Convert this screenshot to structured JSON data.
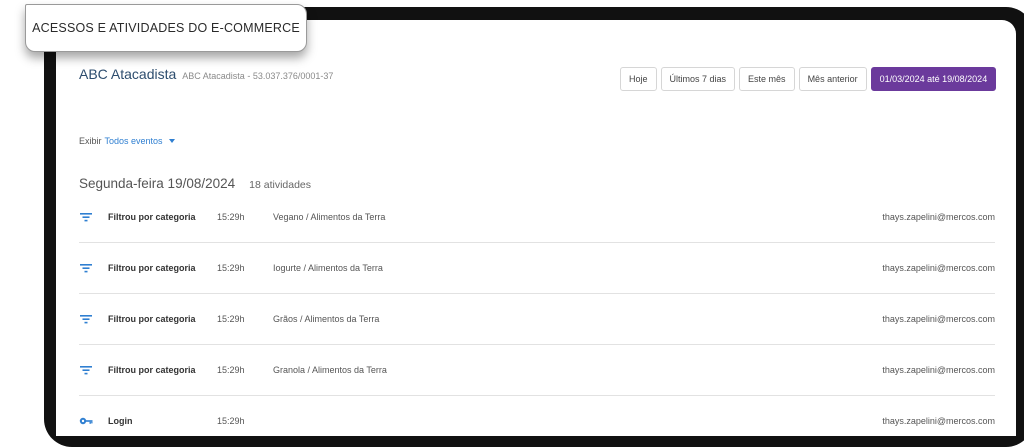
{
  "caption": "ACESSOS E ATIVIDADES DO E-COMMERCE",
  "company": {
    "name": "ABC Atacadista",
    "subtitle": "ABC Atacadista - 53.037.376/0001-37"
  },
  "period_filters": [
    {
      "label": "Hoje",
      "active": false
    },
    {
      "label": "Últimos 7 dias",
      "active": false
    },
    {
      "label": "Este mês",
      "active": false
    },
    {
      "label": "Mês anterior",
      "active": false
    },
    {
      "label": "01/03/2024 até 19/08/2024",
      "active": true
    }
  ],
  "event_filter": {
    "label": "Exibir",
    "value": "Todos eventos"
  },
  "day": {
    "date": "Segunda-feira 19/08/2024",
    "count": "18 atividades"
  },
  "activities": [
    {
      "icon": "filter-icon",
      "action": "Filtrou por categoria",
      "time": "15:29h",
      "description": "Vegano / Alimentos da Terra",
      "user": "thays.zapelini@mercos.com"
    },
    {
      "icon": "filter-icon",
      "action": "Filtrou por categoria",
      "time": "15:29h",
      "description": "Iogurte / Alimentos da Terra",
      "user": "thays.zapelini@mercos.com"
    },
    {
      "icon": "filter-icon",
      "action": "Filtrou por categoria",
      "time": "15:29h",
      "description": "Grãos / Alimentos da Terra",
      "user": "thays.zapelini@mercos.com"
    },
    {
      "icon": "filter-icon",
      "action": "Filtrou por categoria",
      "time": "15:29h",
      "description": "Granola / Alimentos da Terra",
      "user": "thays.zapelini@mercos.com"
    },
    {
      "icon": "key-icon",
      "action": "Login",
      "time": "15:29h",
      "description": "",
      "user": "thays.zapelini@mercos.com"
    }
  ],
  "colors": {
    "accent": "#6b3a9c",
    "icon": "#2f7fd1",
    "link": "#2f7fd1",
    "company": "#2d4d6e"
  }
}
